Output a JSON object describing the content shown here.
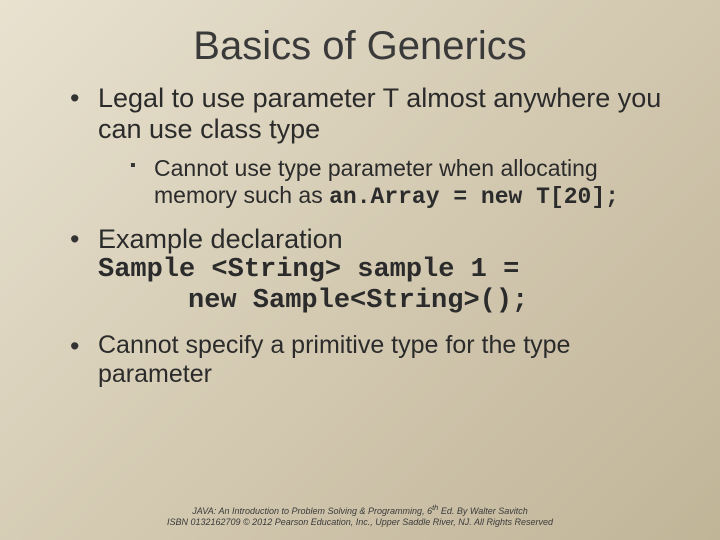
{
  "title": "Basics of Generics",
  "bullets": {
    "b1": {
      "text": "Legal to use parameter T almost anywhere you can use class type",
      "sub1_pre": "Cannot use type parameter when allocating memory such as  ",
      "sub1_code": "an.Array = new T[20];"
    },
    "b2": {
      "text": "Example declaration",
      "code_line1": "Sample <String> sample 1 =",
      "code_line2": "new Sample<String>();"
    },
    "b3": {
      "text": "Cannot specify a primitive type for the type parameter"
    }
  },
  "footer": {
    "line1_pre": "JAVA: An Introduction to Problem Solving & Programming, 6",
    "line1_sup": "th",
    "line1_post": " Ed. By Walter Savitch",
    "line2": "ISBN 0132162709 © 2012 Pearson Education, Inc., Upper Saddle River, NJ. All Rights Reserved"
  }
}
